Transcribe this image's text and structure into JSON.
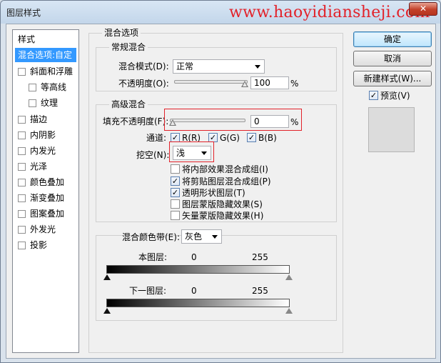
{
  "window": {
    "title": "图层样式",
    "watermark": "www.haoyidiansheji.com",
    "close_glyph": "✕"
  },
  "sidebar": {
    "header": "样式",
    "items": [
      {
        "label": "混合选项:自定",
        "selected": true,
        "checkbox": false
      },
      {
        "label": "斜面和浮雕",
        "checkbox": true,
        "checked": false
      },
      {
        "label": "等高线",
        "checkbox": true,
        "checked": false,
        "indent": true
      },
      {
        "label": "纹理",
        "checkbox": true,
        "checked": false,
        "indent": true
      },
      {
        "label": "描边",
        "checkbox": true,
        "checked": false
      },
      {
        "label": "内阴影",
        "checkbox": true,
        "checked": false
      },
      {
        "label": "内发光",
        "checkbox": true,
        "checked": false
      },
      {
        "label": "光泽",
        "checkbox": true,
        "checked": false
      },
      {
        "label": "颜色叠加",
        "checkbox": true,
        "checked": false
      },
      {
        "label": "渐变叠加",
        "checkbox": true,
        "checked": false
      },
      {
        "label": "图案叠加",
        "checkbox": true,
        "checked": false
      },
      {
        "label": "外发光",
        "checkbox": true,
        "checked": false
      },
      {
        "label": "投影",
        "checkbox": true,
        "checked": false
      }
    ]
  },
  "blending": {
    "section_title": "混合选项",
    "general": {
      "title": "常规混合",
      "mode_label": "混合模式(D):",
      "mode_value": "正常",
      "opacity_label": "不透明度(O):",
      "opacity_value": "100",
      "opacity_unit": "%"
    },
    "advanced": {
      "title": "高级混合",
      "fill_label": "填充不透明度(F):",
      "fill_value": "0",
      "fill_unit": "%",
      "channels_label": "通道:",
      "channels": [
        {
          "label": "R(R)",
          "checked": true
        },
        {
          "label": "G(G)",
          "checked": true
        },
        {
          "label": "B(B)",
          "checked": true
        }
      ],
      "knockout_label": "挖空(N):",
      "knockout_value": "浅",
      "options": [
        {
          "label": "将内部效果混合成组(I)",
          "checked": false
        },
        {
          "label": "将剪贴图层混合成组(P)",
          "checked": true
        },
        {
          "label": "透明形状图层(T)",
          "checked": true
        },
        {
          "label": "图层蒙版隐藏效果(S)",
          "checked": false
        },
        {
          "label": "矢量蒙版隐藏效果(H)",
          "checked": false
        }
      ]
    },
    "blend_if": {
      "label": "混合颜色带(E):",
      "value": "灰色",
      "this_layer_label": "本图层:",
      "this_layer_min": "0",
      "this_layer_max": "255",
      "underlying_label": "下一图层:",
      "underlying_min": "0",
      "underlying_max": "255"
    }
  },
  "buttons": {
    "ok": "确定",
    "cancel": "取消",
    "new_style": "新建样式(W)...",
    "preview_label": "预览(V)",
    "preview_checked": true
  },
  "colors": {
    "highlight": "#e2222a",
    "selection": "#3399ff"
  },
  "check_glyph": "✓"
}
